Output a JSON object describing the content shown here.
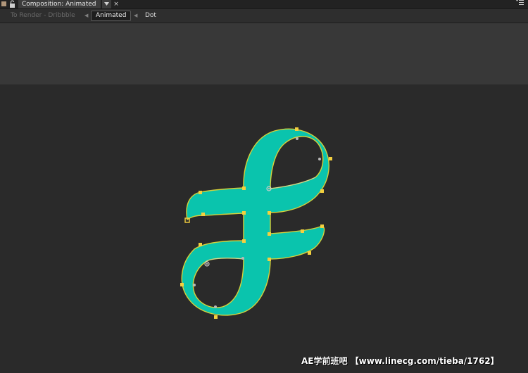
{
  "panel": {
    "tab_title": "Composition: Animated",
    "menu_glyph": "▾",
    "close_glyph": "×",
    "panel_menu_glyph": "▾≡",
    "lock_glyph": "🔓",
    "label_color": "#b0967a"
  },
  "breadcrumbs": [
    {
      "label": "To Render - Dribbble",
      "state": "inactive"
    },
    {
      "label": "Animated",
      "state": "active"
    },
    {
      "label": "Dot",
      "state": "normal"
    }
  ],
  "artwork": {
    "fill_color": "#0ac4ad",
    "outline_color": "#d6d13a",
    "handle_color": "#f4d03f"
  },
  "watermark": {
    "text": "AE学前班吧 【www.linecg.com/tieba/1762】"
  }
}
